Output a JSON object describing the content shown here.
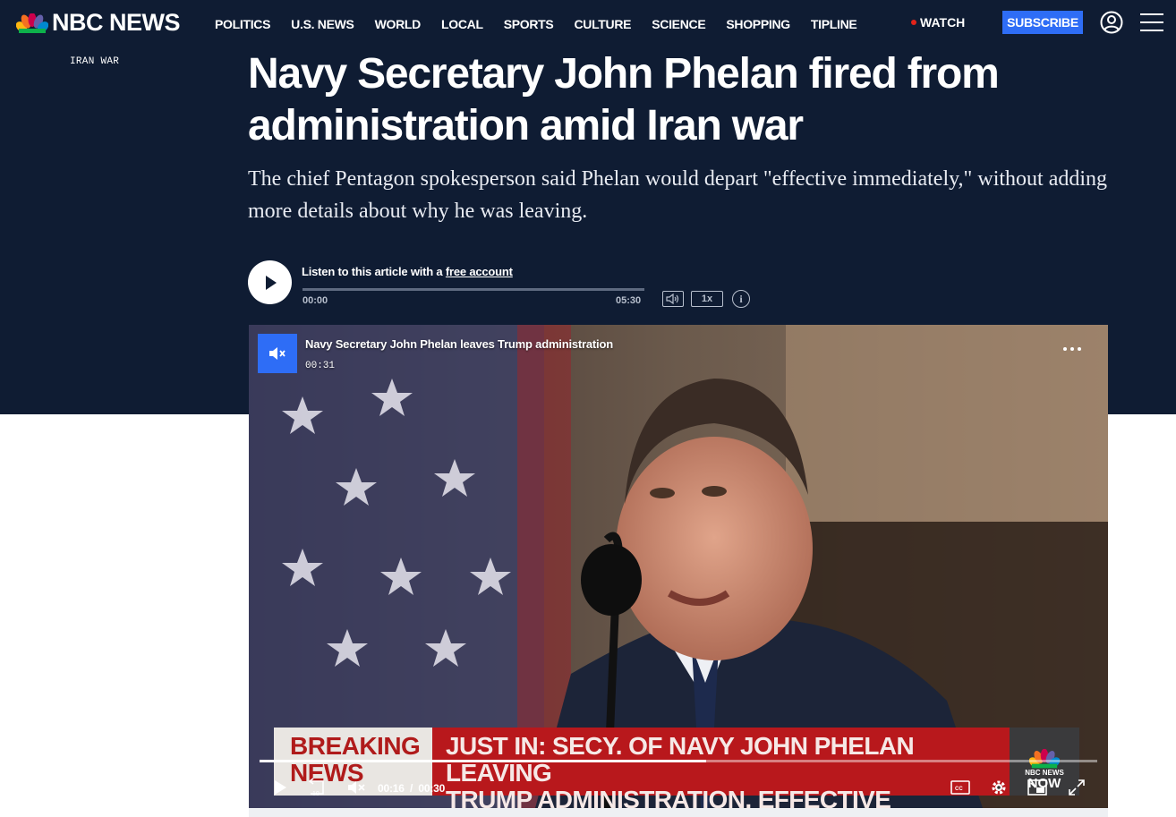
{
  "brand": {
    "name": "NBC NEWS"
  },
  "nav": {
    "items": [
      {
        "label": "POLITICS"
      },
      {
        "label": "U.S. NEWS"
      },
      {
        "label": "WORLD"
      },
      {
        "label": "LOCAL"
      },
      {
        "label": "SPORTS"
      },
      {
        "label": "CULTURE"
      },
      {
        "label": "SCIENCE"
      },
      {
        "label": "SHOPPING"
      },
      {
        "label": "TIPLINE"
      }
    ],
    "watch_label": "WATCH",
    "subscribe_label": "SUBSCRIBE",
    "icons": [
      "user-icon",
      "hamburger-menu-icon"
    ]
  },
  "article": {
    "eyebrow": "IRAN WAR",
    "headline": "Navy Secretary John Phelan fired from administration amid Iran war",
    "dek": "The chief Pentagon spokesperson said Phelan would depart \"effective immediately,\" without adding more details about why he was leaving."
  },
  "audio": {
    "label_prefix": "Listen to this article with a ",
    "link_text": "free account",
    "time_start": "00:00",
    "time_end": "05:30",
    "speed": "1x",
    "info": "i"
  },
  "video": {
    "title": "Navy Secretary John Phelan leaves Trump administration",
    "duration": "00:31",
    "chyron": {
      "breaking_line1": "BREAKING",
      "breaking_line2": "NEWS",
      "main_line1": "JUST IN: SECY. OF NAVY JOHN PHELAN LEAVING",
      "main_line2": "TRUMP ADMINISTRATION, EFFECTIVE IMMEDIATELY",
      "logo_line1": "NBC NEWS",
      "logo_line2": "NOW"
    },
    "current_time": "00:16",
    "time_separator": "/",
    "total_time": "00:30",
    "progress_fraction": 0.533,
    "cc_label": "CC",
    "skip_back_label": "10"
  },
  "colors": {
    "header_bg": "#0f1c33",
    "subscribe": "#2e6df6",
    "live_dot": "#e2231a",
    "chyron_red": "#b8181c"
  }
}
